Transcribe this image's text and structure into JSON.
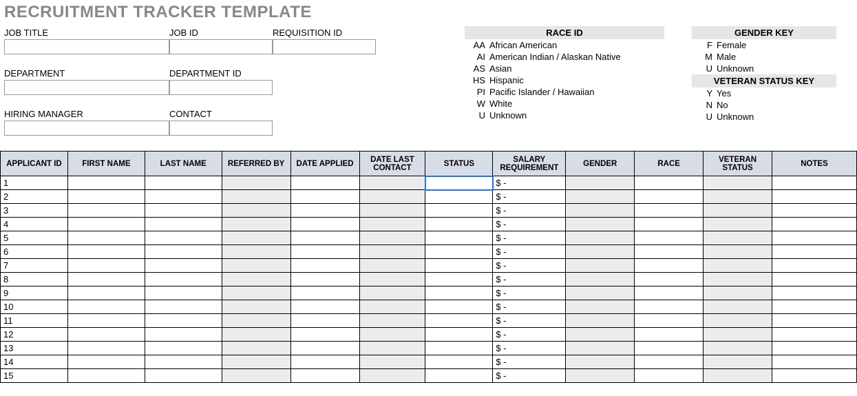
{
  "title": "RECRUITMENT TRACKER TEMPLATE",
  "fields": {
    "job_title_label": "JOB TITLE",
    "job_id_label": "JOB ID",
    "requisition_id_label": "REQUISITION ID",
    "department_label": "DEPARTMENT",
    "department_id_label": "DEPARTMENT ID",
    "hiring_manager_label": "HIRING MANAGER",
    "contact_label": "CONTACT"
  },
  "race_key": {
    "header": "RACE ID",
    "items": [
      {
        "code": "AA",
        "desc": "African American"
      },
      {
        "code": "AI",
        "desc": "American Indian / Alaskan Native"
      },
      {
        "code": "AS",
        "desc": "Asian"
      },
      {
        "code": "HS",
        "desc": "Hispanic"
      },
      {
        "code": "PI",
        "desc": "Pacific Islander / Hawaiian"
      },
      {
        "code": "W",
        "desc": "White"
      },
      {
        "code": "U",
        "desc": "Unknown"
      }
    ]
  },
  "gender_key": {
    "header": "GENDER KEY",
    "items": [
      {
        "code": "F",
        "desc": "Female"
      },
      {
        "code": "M",
        "desc": "Male"
      },
      {
        "code": "U",
        "desc": "Unknown"
      }
    ]
  },
  "veteran_key": {
    "header": "VETERAN STATUS KEY",
    "items": [
      {
        "code": "Y",
        "desc": "Yes"
      },
      {
        "code": "N",
        "desc": "No"
      },
      {
        "code": "U",
        "desc": "Unknown"
      }
    ]
  },
  "table": {
    "headers": [
      "APPLICANT ID",
      "FIRST NAME",
      "LAST NAME",
      "REFERRED BY",
      "DATE APPLIED",
      "DATE LAST CONTACT",
      "STATUS",
      "SALARY REQUIREMENT",
      "GENDER",
      "RACE",
      "VETERAN STATUS",
      "NOTES"
    ],
    "rows": [
      {
        "id": "1",
        "salary": "$ -"
      },
      {
        "id": "2",
        "salary": "$ -"
      },
      {
        "id": "3",
        "salary": "$ -"
      },
      {
        "id": "4",
        "salary": "$ -"
      },
      {
        "id": "5",
        "salary": "$ -"
      },
      {
        "id": "6",
        "salary": "$ -"
      },
      {
        "id": "7",
        "salary": "$ -"
      },
      {
        "id": "8",
        "salary": "$ -"
      },
      {
        "id": "9",
        "salary": "$ -"
      },
      {
        "id": "10",
        "salary": "$ -"
      },
      {
        "id": "11",
        "salary": "$ -"
      },
      {
        "id": "12",
        "salary": "$ -"
      },
      {
        "id": "13",
        "salary": "$ -"
      },
      {
        "id": "14",
        "salary": "$ -"
      },
      {
        "id": "15",
        "salary": "$ -"
      }
    ],
    "selected_row_index": 0
  }
}
